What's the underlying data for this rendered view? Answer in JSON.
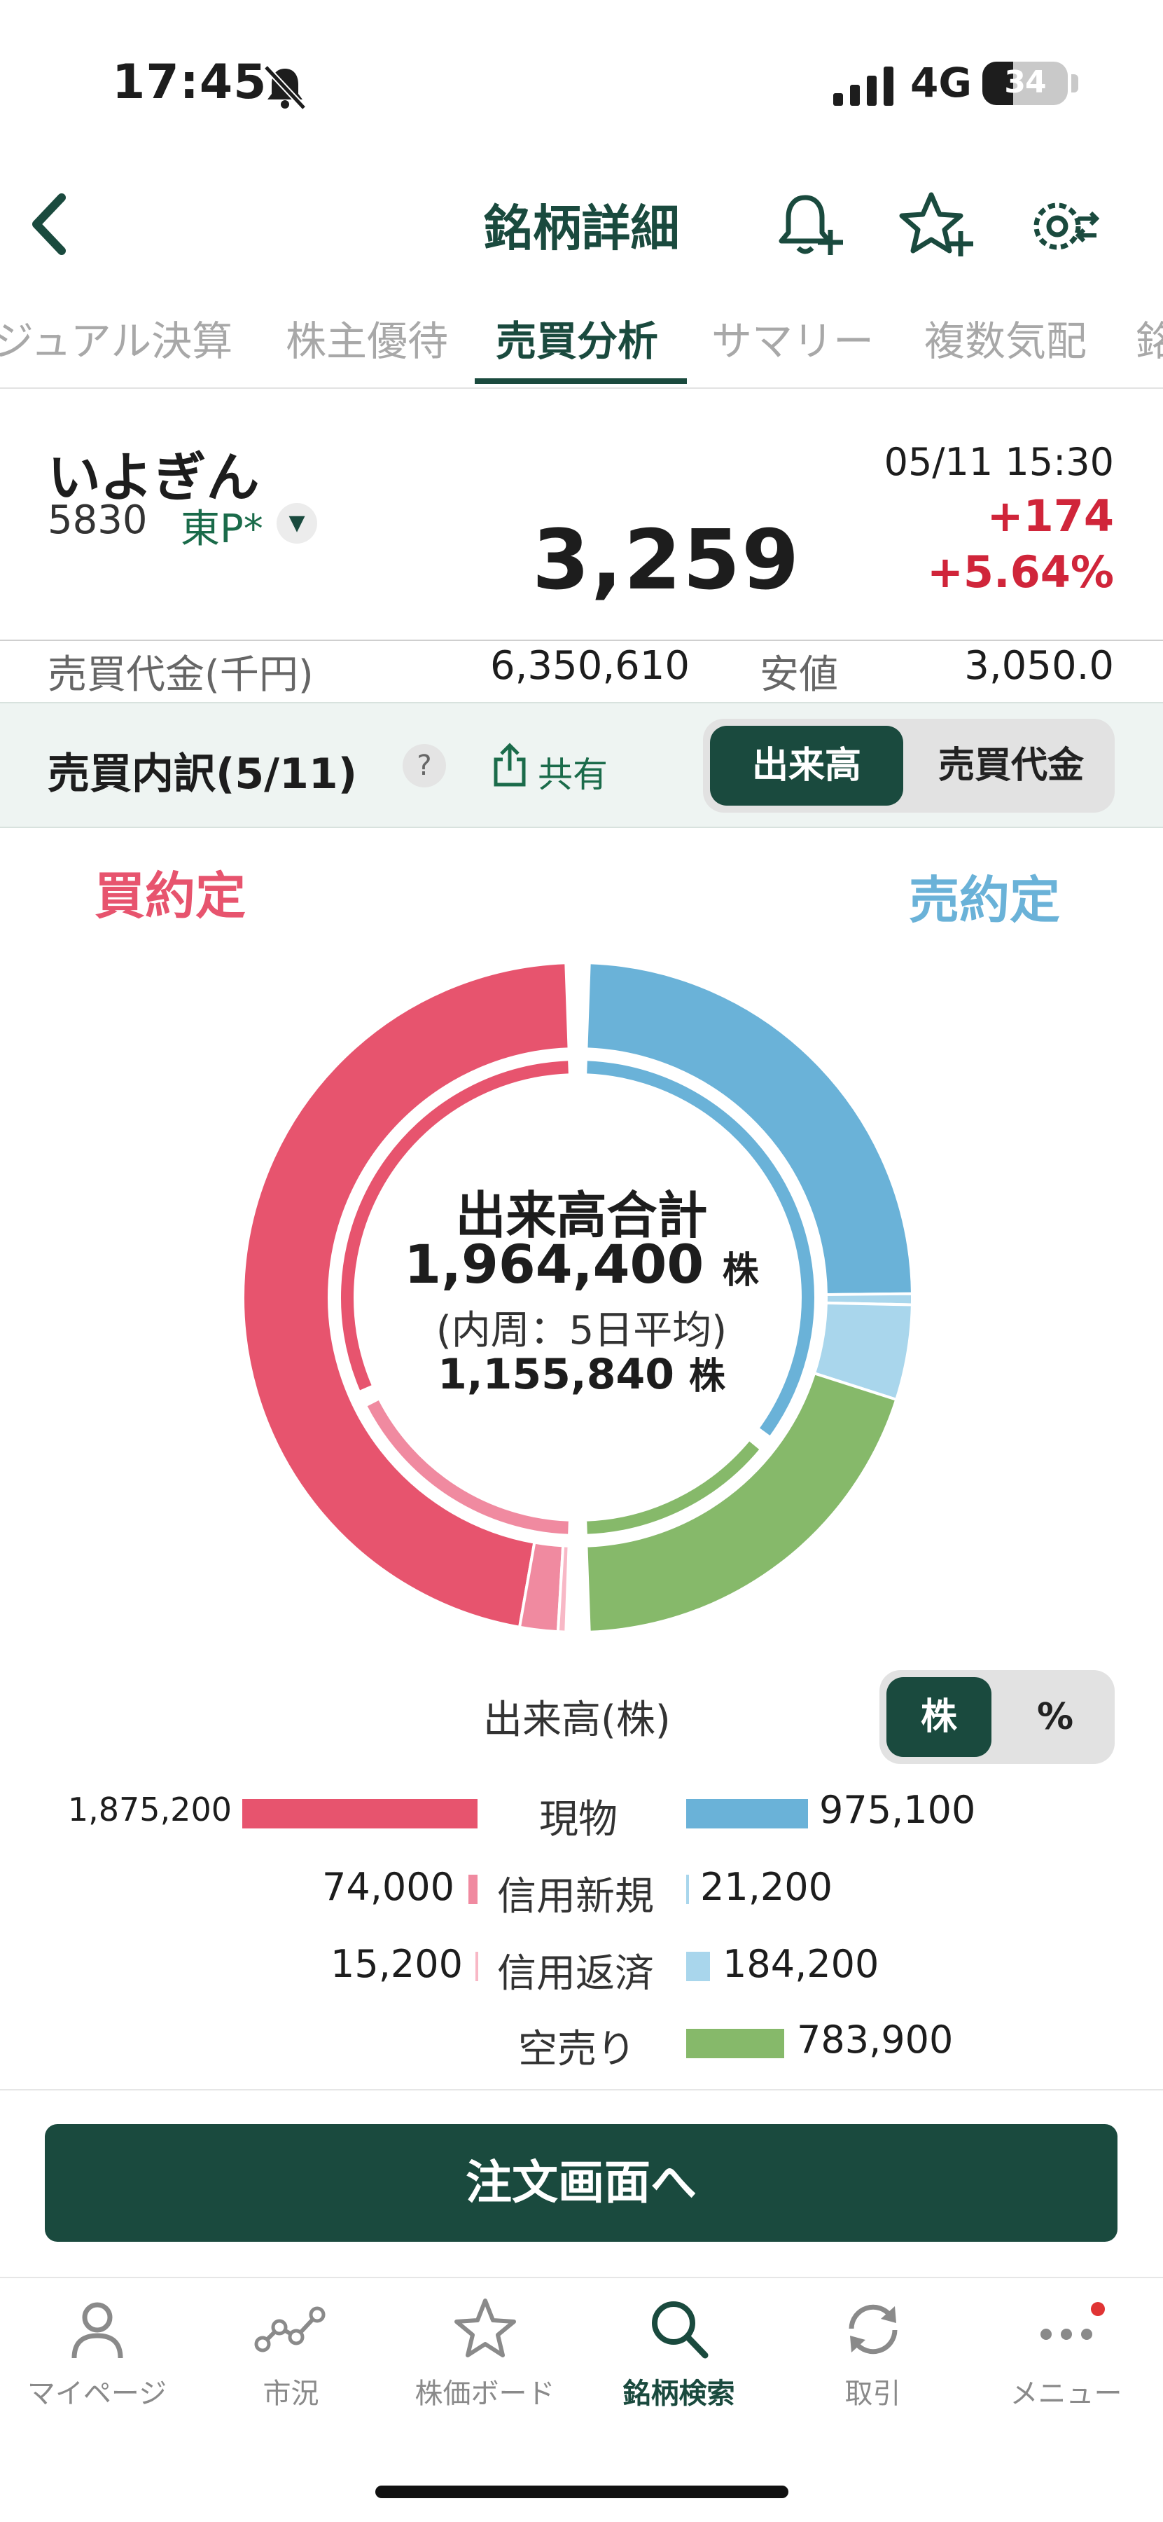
{
  "status_bar": {
    "time": "17:45",
    "network": "4G",
    "battery": "34"
  },
  "header": {
    "title": "銘柄詳細"
  },
  "tabs": [
    {
      "label": "ジュアル決算"
    },
    {
      "label": "株主優待"
    },
    {
      "label": "売買分析",
      "active": true
    },
    {
      "label": "サマリー"
    },
    {
      "label": "複数気配"
    },
    {
      "label": "銘"
    }
  ],
  "stock": {
    "name": "いよぎん",
    "code": "5830",
    "market": "東P*",
    "timestamp": "05/11 15:30",
    "price": "3,259",
    "change": "+174",
    "change_pct": "+5.64%",
    "trading_value_label": "売買代金(千円)",
    "trading_value": "6,350,610",
    "low_label": "安値",
    "low_value": "3,050.0"
  },
  "breakdown": {
    "title": "売買内訳(5/11)",
    "help": "?",
    "share_label": "共有",
    "toggle": [
      "出来高",
      "売買代金"
    ],
    "toggle_selected": "出来高"
  },
  "donut": {
    "buy_label": "買約定",
    "sell_label": "売約定",
    "center_title": "出来高合計",
    "total": "1,964,400",
    "unit": "株",
    "inner_note": "(内周：5日平均)",
    "avg": "1,155,840",
    "colors": {
      "buy": "#e7546e",
      "buy_light": "#f08aa0",
      "sell": "#6ab2d8",
      "sell_light": "#a9d6ec",
      "short": "#86b96a"
    }
  },
  "legend": {
    "volume_label": "出来高(株)",
    "unit_toggle": [
      "株",
      "%"
    ],
    "unit_selected": "株",
    "rows": [
      {
        "label": "現物",
        "buy": "1,875,200",
        "sell": "975,100"
      },
      {
        "label": "信用新規",
        "buy": "74,000",
        "sell": "21,200"
      },
      {
        "label": "信用返済",
        "buy": "15,200",
        "sell": "184,200"
      },
      {
        "label": "空売り",
        "buy": "",
        "sell": "783,900"
      }
    ]
  },
  "chart_data": {
    "type": "pie",
    "title": "出来高合計",
    "series": [
      {
        "name": "買約定",
        "labels": [
          "現物",
          "信用新規",
          "信用返済"
        ],
        "values": [
          1875200,
          74000,
          15200
        ]
      },
      {
        "name": "売約定",
        "labels": [
          "現物",
          "信用新規",
          "信用返済",
          "空売り"
        ],
        "values": [
          975100,
          21200,
          184200,
          783900
        ]
      }
    ],
    "total": 1964400,
    "inner_avg": 1155840
  },
  "order_button": "注文画面へ",
  "bottom_nav": [
    {
      "label": "マイページ",
      "icon": "person-icon"
    },
    {
      "label": "市況",
      "icon": "market-chart-icon"
    },
    {
      "label": "株価ボード",
      "icon": "star-icon"
    },
    {
      "label": "銘柄検索",
      "icon": "search-icon",
      "active": true
    },
    {
      "label": "取引",
      "icon": "refresh-icon"
    },
    {
      "label": "メニュー",
      "icon": "more-icon"
    }
  ]
}
